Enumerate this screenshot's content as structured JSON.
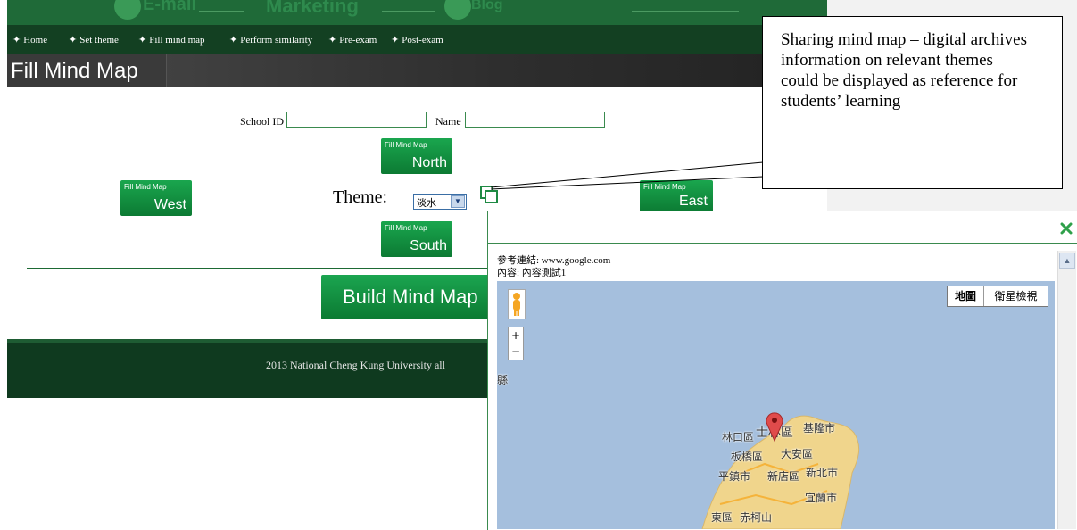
{
  "banner": {
    "items": [
      "E-mail",
      "Marketing",
      "Blog"
    ]
  },
  "nav": {
    "items": [
      "Home",
      "Set theme",
      "Fill mind map",
      "Perform similarity",
      "Pre-exam",
      "Post-exam"
    ]
  },
  "page": {
    "title": "Fill Mind Map"
  },
  "form": {
    "school_id_label": "School ID",
    "school_id_value": "",
    "name_label": "Name",
    "name_value": "",
    "theme_label": "Theme:",
    "theme_value": "淡水"
  },
  "direction_buttons": {
    "caption": "Fill Mind Map",
    "north": "North",
    "west": "West",
    "east": "East",
    "south": "South"
  },
  "build_button": "Build Mind Map",
  "footer": {
    "text": "2013 National Cheng Kung University all"
  },
  "callout": {
    "text": "Sharing mind map – digital archives information on relevant themes could be displayed as reference for students’ learning"
  },
  "popup": {
    "reference_link": "参考連結: www.google.com",
    "content": "內容: 內容測試1",
    "map_types": {
      "map": "地圖",
      "satellite": "衛星檢視"
    },
    "zoom_in": "+",
    "zoom_out": "−",
    "places": [
      "縣",
      "林口區",
      "士林區",
      "基隆市",
      "板橋區",
      "大安區",
      "平鎮市",
      "新店區",
      "新北市",
      "宜蘭市",
      "東區",
      "赤柯山"
    ]
  },
  "colors": {
    "header_green": "#1f6a38",
    "nav_dark": "#134022",
    "button_green": "#12903f",
    "map_water": "#a5bfdd",
    "map_land": "#f0d58c"
  },
  "icons": {
    "nav_bullet": "star-icon",
    "copy": "copy-icon",
    "close": "close-icon",
    "pegman": "pegman-icon",
    "marker": "map-marker-icon"
  }
}
